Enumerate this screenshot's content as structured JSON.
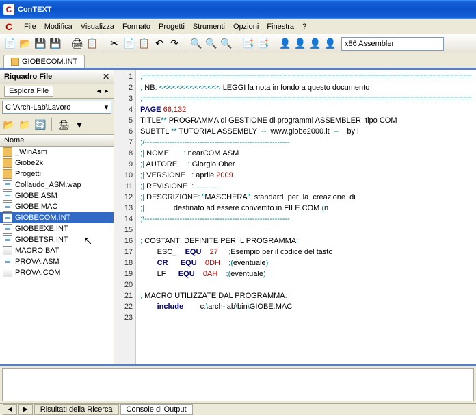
{
  "window": {
    "title": "ConTEXT",
    "app_icon_letter": "C"
  },
  "menu": {
    "file": "File",
    "modifica": "Modifica",
    "visualizza": "Visualizza",
    "formato": "Formato",
    "progetti": "Progetti",
    "strumenti": "Strumenti",
    "opzioni": "Opzioni",
    "finestra": "Finestra",
    "help": "?"
  },
  "toolbar": {
    "assembler_combo": "x86 Assembler"
  },
  "tabs": {
    "active": "GIOBECOM.INT"
  },
  "sidebar": {
    "title": "Riquadro File",
    "explore_tab": "Esplora File",
    "path": "C:\\Arch-Lab\\Lavoro",
    "column": "Nome",
    "items": [
      {
        "name": "_WinAsm",
        "type": "folder"
      },
      {
        "name": "Giobe2k",
        "type": "folder"
      },
      {
        "name": "Progetti",
        "type": "folder"
      },
      {
        "name": "Collaudo_ASM.wap",
        "type": "file"
      },
      {
        "name": "GIOBE.ASM",
        "type": "file"
      },
      {
        "name": "GIOBE.MAC",
        "type": "file"
      },
      {
        "name": "GIOBECOM.INT",
        "type": "file",
        "selected": true
      },
      {
        "name": "GIOBEEXE.INT",
        "type": "file"
      },
      {
        "name": "GIOBETSR.INT",
        "type": "file"
      },
      {
        "name": "MACRO.BAT",
        "type": "prog"
      },
      {
        "name": "PROVA.ASM",
        "type": "file"
      },
      {
        "name": "PROVA.COM",
        "type": "prog"
      }
    ]
  },
  "editor": {
    "lines": [
      {
        "n": 1,
        "html": "<span class='sc'>;===========================================================================</span>"
      },
      {
        "n": 2,
        "html": "<span class='sc'>;</span> <span class='txt'>NB</span><span class='sc'>:</span> <span class='sc'>&lt;&lt;&lt;&lt;&lt;&lt;&lt;&lt;&lt;&lt;&lt;&lt;&lt;&lt;</span> <span class='txt'>LEGGI la nota in fondo a questo documento</span>"
      },
      {
        "n": 3,
        "html": "<span class='sc'>;===========================================================================</span>"
      },
      {
        "n": 4,
        "html": "<span class='kw'>PAGE</span> <span class='num'>66</span><span class='sc'>,</span><span class='num'>132</span>"
      },
      {
        "n": 5,
        "html": "<span class='txt'>TITLE</span><span class='sc'>**</span> <span class='txt'>PROGRAMMA di GESTIONE di programmi ASSEMBLER  tipo COM</span>"
      },
      {
        "n": 6,
        "html": "<span class='txt'>SUBTTL</span> <span class='sc'>**</span> <span class='txt'>TUTORIAL ASSEMBLY  </span><span class='sc'>--</span><span class='txt'>  www</span><span class='sc'>.</span><span class='txt'>giobe2000</span><span class='sc'>.</span><span class='txt'>it  </span><span class='sc'>--</span><span class='txt'>    by i</span>"
      },
      {
        "n": 7,
        "html": "<span class='sc'>;/----------------------------------------------------------</span>"
      },
      {
        "n": 8,
        "html": "<span class='sc'>;|</span> <span class='txt'>NOME       </span><span class='sc'>:</span> <span class='txt'>nearCOM</span><span class='sc'>.</span><span class='txt'>ASM</span>"
      },
      {
        "n": 9,
        "html": "<span class='sc'>;|</span> <span class='txt'>AUTORE     </span><span class='sc'>:</span> <span class='txt'>Giorgio Ober</span>"
      },
      {
        "n": 10,
        "html": "<span class='sc'>;|</span> <span class='txt'>VERSIONE   </span><span class='sc'>:</span> <span class='txt'>aprile </span><span class='num'>2009</span>"
      },
      {
        "n": 11,
        "html": "<span class='sc'>;|</span> <span class='txt'>REVISIONE  </span><span class='sc'>: ....... ....</span>"
      },
      {
        "n": 12,
        "html": "<span class='sc'>;|</span> <span class='txt'>DESCRIZIONE</span><span class='sc'>:</span><span class='txt'> </span><span class='sc'>\"</span><span class='txt'>MASCHERA</span><span class='sc'>\"</span><span class='txt'>  standard  per  la  creazione  di  </span>"
      },
      {
        "n": 13,
        "html": "<span class='sc'>;|</span> <span class='txt'>             destinato ad essere convertito in FILE</span><span class='sc'>.</span><span class='txt'>COM </span><span class='sc'>(</span><span class='txt'>n</span>"
      },
      {
        "n": 14,
        "html": "<span class='sc'>;\\----------------------------------------------------------</span>"
      },
      {
        "n": 15,
        "html": ""
      },
      {
        "n": 16,
        "html": "<span class='sc'>;</span> <span class='txt'>COSTANTI DEFINITE PER IL PROGRAMMA</span><span class='sc'>:</span>"
      },
      {
        "n": 17,
        "html": "        <span class='txt'>ESC_    </span><span class='kw'>EQU</span>    <span class='num'>27</span>     <span class='sc'>;</span><span class='txt'>Esempio per il codice del tasto</span>"
      },
      {
        "n": 18,
        "html": "        <span class='kw'>CR</span>      <span class='kw'>EQU</span>    <span class='num'>0DH</span>    <span class='sc'>;(</span><span class='txt'>eventuale</span><span class='sc'>)</span>"
      },
      {
        "n": 19,
        "html": "        <span class='txt'>LF      </span><span class='kw'>EQU</span>    <span class='num'>0AH</span>    <span class='sc'>;(</span><span class='txt'>eventuale</span><span class='sc'>)</span>"
      },
      {
        "n": 20,
        "html": ""
      },
      {
        "n": 21,
        "html": "<span class='sc'>;</span> <span class='txt'>MACRO UTILIZZATE DAL PROGRAMMA</span><span class='sc'>:</span>"
      },
      {
        "n": 22,
        "html": "        <span class='kw'>include</span>        <span class='txt'>c</span><span class='sc'>:\\</span><span class='txt'>arch</span><span class='sc'>-</span><span class='txt'>lab</span><span class='sc'>\\</span><span class='txt'>bin</span><span class='sc'>\\</span><span class='txt'>GIOBE</span><span class='sc'>.</span><span class='txt'>MAC</span>"
      },
      {
        "n": 23,
        "html": ""
      }
    ]
  },
  "footer": {
    "search_results": "Risultati della Ricerca",
    "output_console": "Console di Output"
  }
}
